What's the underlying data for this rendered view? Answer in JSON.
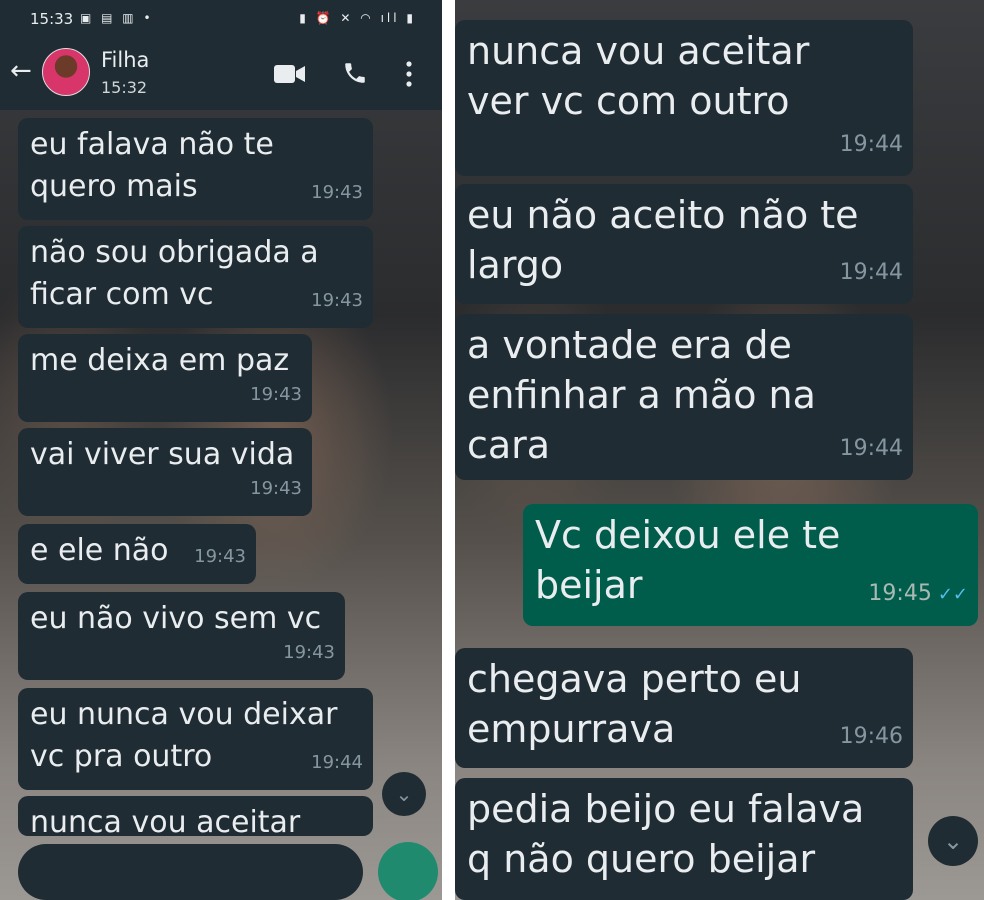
{
  "status_bar": {
    "time": "15:33",
    "left_icons": "▣ ▤ ▥ •",
    "right_icons": "▮ ⏰ ✕ ◠ ıll ▮"
  },
  "header": {
    "back_glyph": "←",
    "contact_name": "Filha",
    "contact_subtitle": "15:32"
  },
  "colors": {
    "header_bg": "#1f2c33",
    "incoming_bubble": "#1f2c33",
    "outgoing_bubble": "#005c4b",
    "timestamp": "#8696a0",
    "read_ticks": "#53bdeb"
  },
  "left_messages": [
    {
      "text": "eu falava não te\nquero mais",
      "time": "19:43"
    },
    {
      "text": "não sou obrigada a\nficar com vc",
      "time": "19:43"
    },
    {
      "text": "me deixa em paz",
      "time": "19:43"
    },
    {
      "text": "vai viver sua vida",
      "time": "19:43"
    },
    {
      "text": "e ele não",
      "time": "19:43"
    },
    {
      "text": "eu não vivo sem vc",
      "time": "19:43"
    },
    {
      "text": "eu nunca vou deixar\nvc pra outro",
      "time": "19:44"
    },
    {
      "text": "nunca vou aceitar",
      "time": ""
    }
  ],
  "right_messages": [
    {
      "text": "nunca vou aceitar\nver vc com outro",
      "time": "19:44",
      "direction": "in"
    },
    {
      "text": "eu não aceito não te\nlargo",
      "time": "19:44",
      "direction": "in"
    },
    {
      "text": "a vontade era de\nenfinhar a mão na\ncara",
      "time": "19:44",
      "direction": "in"
    },
    {
      "text": "Vc deixou ele te\nbeijar",
      "time": "19:45",
      "direction": "out",
      "ticks": "✓✓"
    },
    {
      "text": "chegava perto eu\nempurrava",
      "time": "19:46",
      "direction": "in"
    },
    {
      "text": "pedia beijo eu falava\nq não quero beijar",
      "time": "",
      "direction": "in"
    }
  ],
  "scroll_down_glyph": "⌄"
}
